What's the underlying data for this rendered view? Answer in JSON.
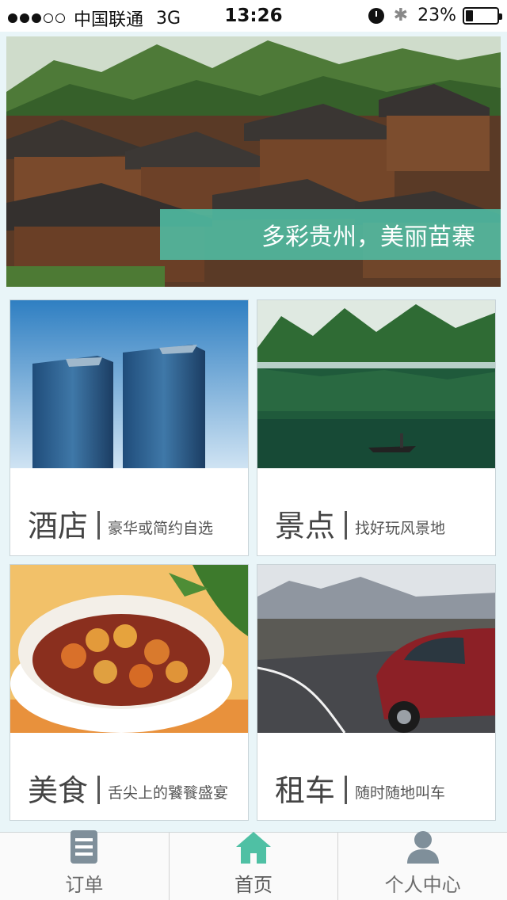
{
  "status_bar": {
    "carrier": "中国联通",
    "network": "3G",
    "time": "13:26",
    "battery": "23%",
    "signal_bars": 3,
    "signal_total": 5,
    "battery_level": 0.23
  },
  "banner": {
    "caption": "多彩贵州，美丽苗寨"
  },
  "cards": [
    {
      "title": "酒店",
      "desc": "豪华或简约自选"
    },
    {
      "title": "景点",
      "desc": "找好玩风景地"
    },
    {
      "title": "美食",
      "desc": "舌尖上的饕餮盛宴"
    },
    {
      "title": "租车",
      "desc": "随时随地叫车"
    }
  ],
  "tabs": [
    {
      "label": "订单",
      "icon": "order-list-icon"
    },
    {
      "label": "首页",
      "icon": "home-icon",
      "active": true
    },
    {
      "label": "个人中心",
      "icon": "user-icon"
    }
  ],
  "colors": {
    "accent": "#4fc0a4",
    "background": "#e9f5f8",
    "icon_gray": "#7f8f9a"
  }
}
